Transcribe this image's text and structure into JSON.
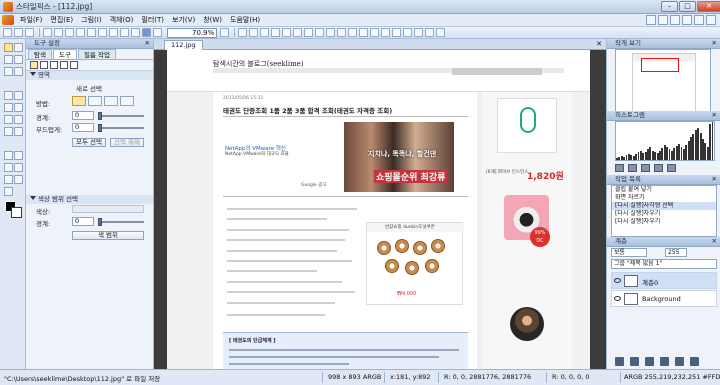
{
  "window": {
    "title": "스타일픽스 - [112.jpg]",
    "minimize": "–",
    "maximize": "□",
    "close": "✕"
  },
  "menu": [
    "파일(F)",
    "편집(E)",
    "그림(I)",
    "객체(O)",
    "필터(T)",
    "보기(V)",
    "창(W)",
    "도움말(H)"
  ],
  "toolbar": {
    "zoom": "70.9%"
  },
  "tool_options": {
    "panel_title": "도구 설정",
    "tabs": [
      "탐색",
      "도구",
      "필름 작업"
    ],
    "active_tab": 1,
    "section_select": "영역",
    "new_selection_label": "새로 선택",
    "method_label": "방법:",
    "border_label": "경계:",
    "border_value": "0",
    "feather_label": "부드럽게:",
    "feather_value": "0",
    "select_all_button": "모두 선택",
    "deselect_button": "선택 해제",
    "section_color": "색상 범위 선택",
    "color_label": "색상:",
    "tolerance_label": "경계:",
    "tolerance_value": "0",
    "color_range_button": "색 범위"
  },
  "document": {
    "tab_label": "112.jpg"
  },
  "webpage": {
    "blog_name": "탐색시간의 블로그(seeklime)",
    "post_meta": "2011/05/06 15:31",
    "post_title": "태권도 단증조회 1품 2품 3품 합격 조회(태권도 자격증 조회)",
    "ad_caption_1": "지치냐, 똑똑냐, 할건댄",
    "ad_caption_2": "쇼핑몰순위 최강류",
    "vm_link": "NetApp의 VMware 혁신",
    "vm_sub": "NetApp VMware와 대규모 효율",
    "google_ad": "Google 광고",
    "promo_header": "반값쇼핑 dunkin도넛쿠폰",
    "promo_price": "₩4,000",
    "info_title": "[ 태권도의 단급체계 ]",
    "side_price": "1,820원",
    "side_price_label": "[6개] 파이브 인스턴스",
    "side_badge": "99% DC"
  },
  "navigator": {
    "title": "작게 보기"
  },
  "histogram": {
    "title": "히스토그램",
    "bars": [
      2,
      3,
      4,
      3,
      5,
      6,
      5,
      4,
      6,
      8,
      9,
      7,
      8,
      10,
      12,
      9,
      8,
      7,
      9,
      11,
      14,
      12,
      10,
      9,
      11,
      13,
      15,
      12,
      10,
      14,
      18,
      22,
      25,
      28,
      30,
      26,
      20,
      16,
      12,
      34,
      36
    ]
  },
  "history": {
    "title": "작업 목록",
    "items": [
      "클립 붙여 넣기",
      "화면 자르기",
      "[다시 실행]사각형 선택",
      "[다시 실행]자우기",
      "[다시 실행]자우기"
    ],
    "selected": 2
  },
  "layers": {
    "title": "계층",
    "blend_mode": "보통",
    "opacity": "255",
    "group_label": "그룹 \"제목 없음 1\"",
    "items": [
      {
        "name": "계층0"
      },
      {
        "name": "Background"
      }
    ]
  },
  "status": {
    "message": "\"C:\\Users\\seeklime\\Desktop\\112.jpg\" 로 파일 저장",
    "size": "998 x 893 ARGB",
    "coords": "x:181, y:892",
    "region": "R: 0, 0, 2881776, 2881776",
    "color": "R: 0, 0, 0, 0",
    "argb": "ARGB 255,219,232,251 #FFDBE8FB"
  }
}
